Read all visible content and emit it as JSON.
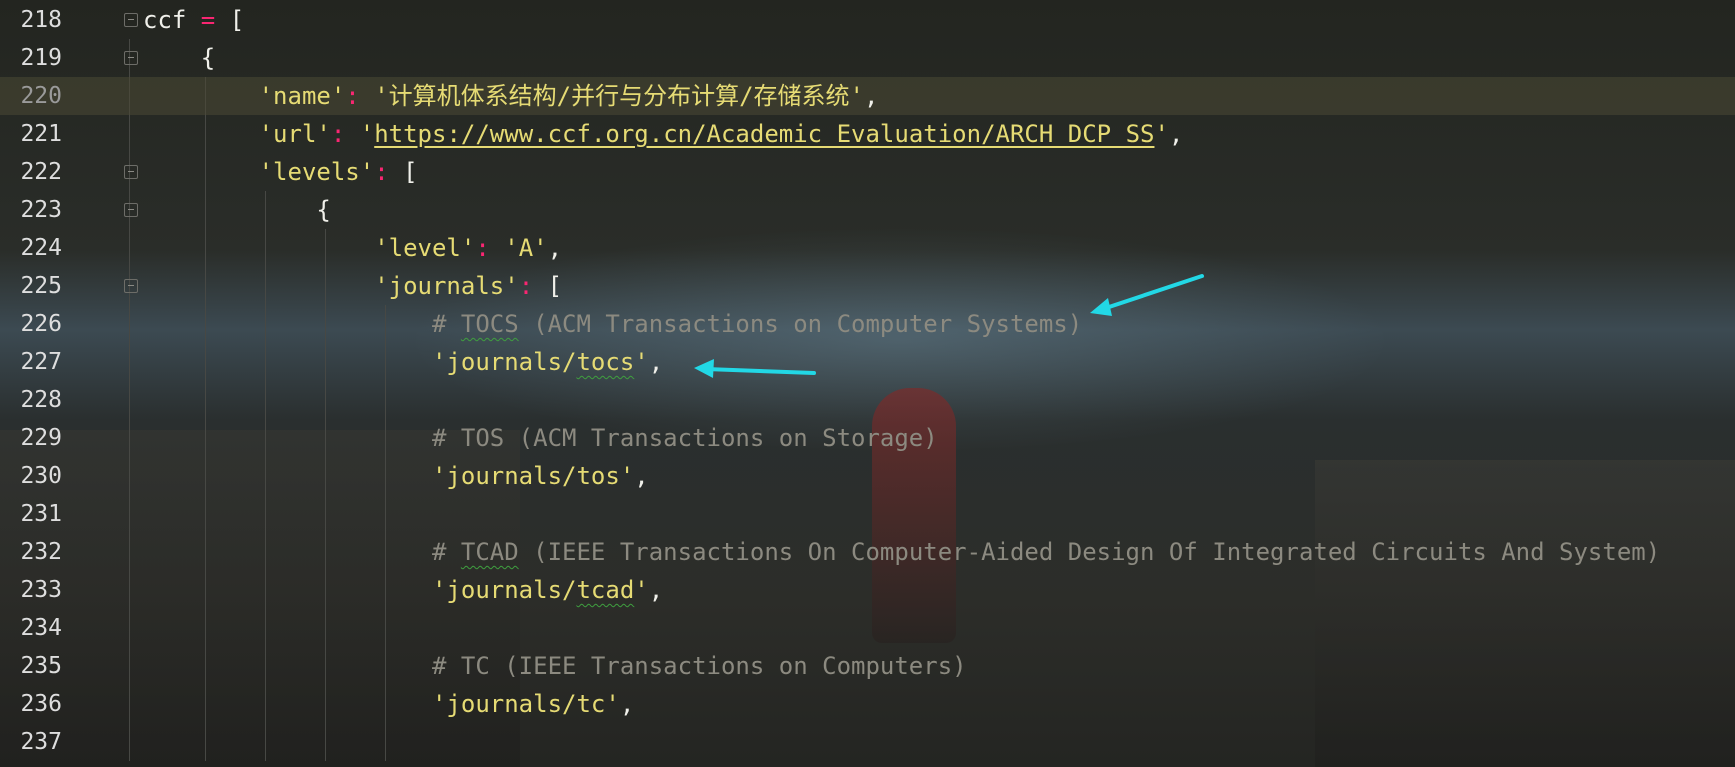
{
  "editor": {
    "lines": [
      {
        "num": "218",
        "parts": [
          {
            "t": "ccf ",
            "c": "pl"
          },
          {
            "t": "=",
            "c": "kw"
          },
          {
            "t": " [",
            "c": "pl"
          }
        ]
      },
      {
        "num": "219",
        "parts": [
          {
            "t": "    {",
            "c": "pl"
          }
        ]
      },
      {
        "num": "220",
        "parts": [
          {
            "t": "        'name'",
            "c": "str"
          },
          {
            "t": ":",
            "c": "kw"
          },
          {
            "t": " '计算机体系结构/并行与分布计算/存储系统'",
            "c": "str"
          },
          {
            "t": ",",
            "c": "pl"
          }
        ]
      },
      {
        "num": "221",
        "parts": [
          {
            "t": "        'url'",
            "c": "str"
          },
          {
            "t": ":",
            "c": "kw"
          },
          {
            "t": " '",
            "c": "str"
          },
          {
            "t": "https://www.ccf.org.cn/Academic_Evaluation/ARCH_DCP_SS",
            "c": "url"
          },
          {
            "t": "'",
            "c": "str"
          },
          {
            "t": ",",
            "c": "pl"
          }
        ]
      },
      {
        "num": "222",
        "parts": [
          {
            "t": "        'levels'",
            "c": "str"
          },
          {
            "t": ":",
            "c": "kw"
          },
          {
            "t": " [",
            "c": "pl"
          }
        ]
      },
      {
        "num": "223",
        "parts": [
          {
            "t": "            {",
            "c": "pl"
          }
        ]
      },
      {
        "num": "224",
        "parts": [
          {
            "t": "                'level'",
            "c": "str"
          },
          {
            "t": ":",
            "c": "kw"
          },
          {
            "t": " 'A'",
            "c": "str"
          },
          {
            "t": ",",
            "c": "pl"
          }
        ]
      },
      {
        "num": "225",
        "parts": [
          {
            "t": "                'journals'",
            "c": "str"
          },
          {
            "t": ":",
            "c": "kw"
          },
          {
            "t": " [",
            "c": "pl"
          }
        ]
      },
      {
        "num": "226",
        "parts": [
          {
            "t": "                    # ",
            "c": "cm"
          },
          {
            "t": "TOCS",
            "c": "cm sq"
          },
          {
            "t": " (ACM Transactions on Computer Systems)",
            "c": "cm"
          }
        ]
      },
      {
        "num": "227",
        "parts": [
          {
            "t": "                    'journals/",
            "c": "str"
          },
          {
            "t": "tocs",
            "c": "str sq"
          },
          {
            "t": "'",
            "c": "str"
          },
          {
            "t": ",",
            "c": "pl"
          }
        ]
      },
      {
        "num": "228",
        "parts": []
      },
      {
        "num": "229",
        "parts": [
          {
            "t": "                    # TOS (ACM Transactions on Storage)",
            "c": "cm"
          }
        ]
      },
      {
        "num": "230",
        "parts": [
          {
            "t": "                    'journals/tos'",
            "c": "str"
          },
          {
            "t": ",",
            "c": "pl"
          }
        ]
      },
      {
        "num": "231",
        "parts": []
      },
      {
        "num": "232",
        "parts": [
          {
            "t": "                    # ",
            "c": "cm"
          },
          {
            "t": "TCAD",
            "c": "cm sq"
          },
          {
            "t": " (IEEE Transactions On Computer-Aided Design Of Integrated Circuits And System)",
            "c": "cm"
          }
        ]
      },
      {
        "num": "233",
        "parts": [
          {
            "t": "                    'journals/",
            "c": "str"
          },
          {
            "t": "tcad",
            "c": "str sq"
          },
          {
            "t": "'",
            "c": "str"
          },
          {
            "t": ",",
            "c": "pl"
          }
        ]
      },
      {
        "num": "234",
        "parts": []
      },
      {
        "num": "235",
        "parts": [
          {
            "t": "                    # TC (IEEE Transactions on Computers)",
            "c": "cm"
          }
        ]
      },
      {
        "num": "236",
        "parts": [
          {
            "t": "                    'journals/tc'",
            "c": "str"
          },
          {
            "t": ",",
            "c": "pl"
          }
        ]
      },
      {
        "num": "237",
        "parts": []
      }
    ],
    "current_line": "220",
    "fold_markers": [
      "218",
      "219",
      "222",
      "223",
      "225"
    ]
  },
  "annotations": [
    {
      "name": "arrow-to-comment",
      "color": "#22d8e6"
    },
    {
      "name": "arrow-to-journal",
      "color": "#22d8e6"
    }
  ]
}
